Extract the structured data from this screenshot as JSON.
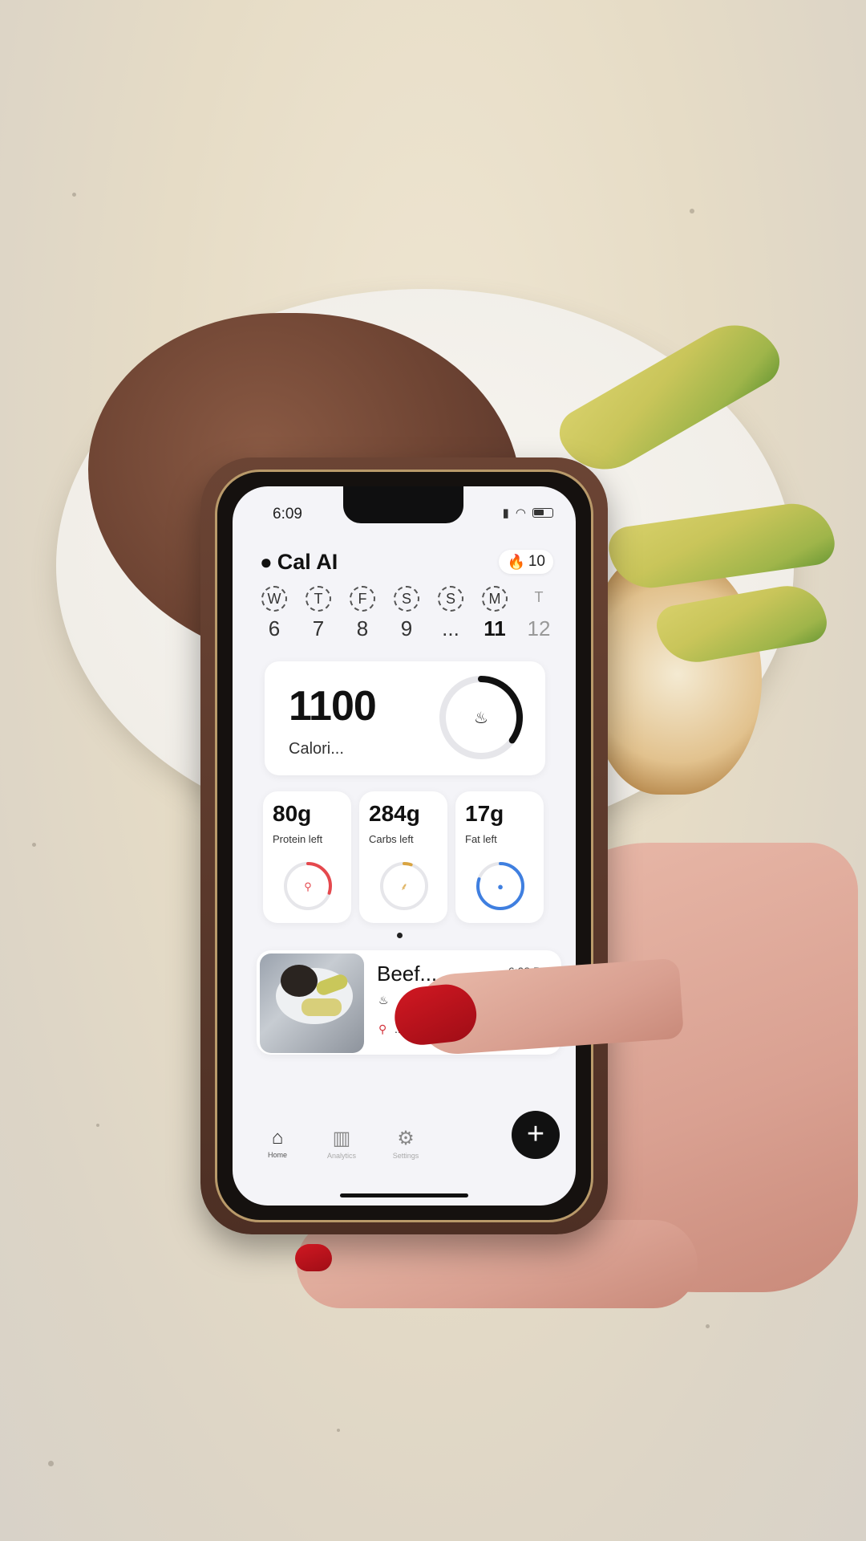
{
  "status_bar": {
    "time": "6:09"
  },
  "header": {
    "title": "Cal AI",
    "streak_count": "10"
  },
  "week": [
    {
      "letter": "W",
      "date": "6"
    },
    {
      "letter": "T",
      "date": "7"
    },
    {
      "letter": "F",
      "date": "8"
    },
    {
      "letter": "S",
      "date": "9"
    },
    {
      "letter": "S",
      "date": "..."
    },
    {
      "letter": "M",
      "date": "11"
    },
    {
      "letter": "T",
      "date": "12"
    }
  ],
  "calories": {
    "value": "1100",
    "label": "Calori...",
    "ring_progress": 0.35
  },
  "macros": [
    {
      "value": "80g",
      "label": "Protein left",
      "progress": 0.3,
      "color": "#e5484d"
    },
    {
      "value": "284g",
      "label": "Carbs left",
      "progress": 0.05,
      "color": "#d9a441"
    },
    {
      "value": "17g",
      "label": "Fat left",
      "progress": 0.8,
      "color": "#3f7fe0"
    }
  ],
  "recent_meal": {
    "name": "Beef...",
    "time": "6:08 PM",
    "more": "..."
  },
  "tabs": {
    "home": "Home",
    "analytics": "Analytics",
    "settings": "Settings"
  },
  "add_button": "+",
  "colors": {
    "accent": "#111111",
    "background": "#f4f4f8",
    "ring_track": "#e6e6ea"
  }
}
